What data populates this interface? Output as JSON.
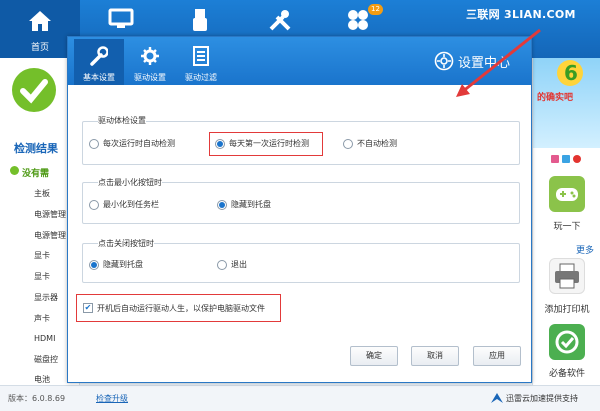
{
  "app": {
    "nav": {
      "home_label": "首页",
      "badge_count": "12"
    },
    "watermark": "三联网 3LIAN.COM",
    "left": {
      "title": "检测结果",
      "status": "没有需",
      "items": [
        "主板",
        "电源管理",
        "电源管理",
        "显卡",
        "显卡",
        "显示器",
        "声卡",
        "HDMI",
        "磁盘控",
        "电池"
      ]
    },
    "right": {
      "banner_text": "的确实吧",
      "more_label": "更多",
      "tiles": [
        {
          "label": "玩一下",
          "icon": "gamepad-icon"
        },
        {
          "label": "添加打印机",
          "icon": "printer-icon"
        },
        {
          "label": "必备软件",
          "icon": "software-icon"
        }
      ]
    },
    "footer": {
      "version": "版本：6.0.8.69",
      "upgrade_link": "检查升级",
      "support": "迅雷云加速提供支持"
    }
  },
  "dialog": {
    "title": "设置中心",
    "tabs": [
      {
        "label": "基本设置",
        "icon": "wrench-icon",
        "active": true
      },
      {
        "label": "驱动设置",
        "icon": "gear-icon",
        "active": false
      },
      {
        "label": "驱动过滤",
        "icon": "list-icon",
        "active": false
      }
    ],
    "groups": {
      "check": {
        "title": "驱动体检设置",
        "options": [
          "每次运行时自动检测",
          "每天第一次运行时检测",
          "不自动检测"
        ],
        "selected": 1
      },
      "minimize": {
        "title": "点击最小化按钮时",
        "options": [
          "最小化到任务栏",
          "隐藏到托盘"
        ],
        "selected": 1
      },
      "close": {
        "title": "点击关闭按钮时",
        "options": [
          "隐藏到托盘",
          "退出"
        ],
        "selected": 0
      }
    },
    "autostart": {
      "label": "开机后自动运行驱动人生，以保护电脑驱动文件",
      "checked": true
    },
    "buttons": {
      "ok": "确定",
      "cancel": "取消",
      "apply": "应用"
    }
  },
  "colors": {
    "brand_blue": "#1a74cc",
    "highlight_red": "#e23a3a",
    "ok_green": "#74bf2a"
  }
}
